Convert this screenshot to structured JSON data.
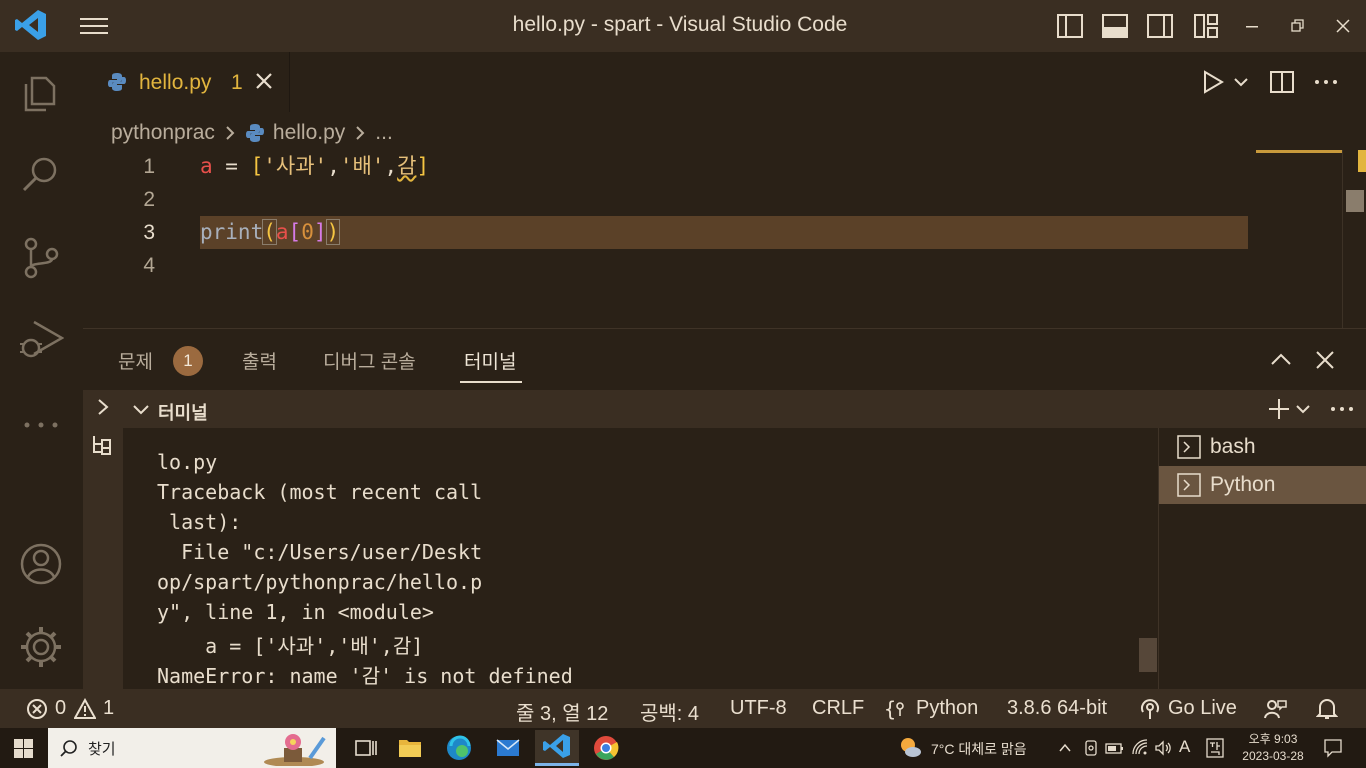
{
  "window": {
    "title": "hello.py - spart - Visual Studio Code"
  },
  "editor": {
    "tab": {
      "label": "hello.py",
      "problem_count": "1"
    },
    "breadcrumb": {
      "folder": "pythonprac",
      "file": "hello.py",
      "more": "..."
    },
    "lines": [
      {
        "number": "1"
      },
      {
        "number": "2"
      },
      {
        "number": "3"
      },
      {
        "number": "4"
      }
    ],
    "code": {
      "line1": {
        "var": "a",
        "eq": " = ",
        "open": "[",
        "s1": "'사과'",
        "c1": ",",
        "s2": "'배'",
        "c2": ",",
        "bad": "감",
        "close": "]"
      },
      "line3": {
        "fn": "print",
        "open": "(",
        "var": "a",
        "open2": "[",
        "num": "0",
        "close2": "]",
        "close": ")"
      }
    }
  },
  "panel": {
    "tabs": [
      {
        "label": "문제"
      },
      {
        "label": "출력"
      },
      {
        "label": "디버그 콘솔"
      },
      {
        "label": "터미널"
      }
    ],
    "problems_badge": "1",
    "terminal_header": "터미널",
    "terminal_lines": [
      "lo.py",
      "Traceback (most recent call",
      " last):",
      "  File \"c:/Users/user/Deskt",
      "op/spart/pythonprac/hello.p",
      "y\", line 1, in <module>",
      "    a = ['사과','배',감]",
      "NameError: name '감' is not defined"
    ],
    "terminals": [
      {
        "label": "bash"
      },
      {
        "label": "Python"
      }
    ]
  },
  "statusbar": {
    "errors": "0",
    "warnings": "1",
    "position": "줄 3, 열 12",
    "spaces": "공백: 4",
    "encoding": "UTF-8",
    "eol": "CRLF",
    "language": "Python",
    "interpreter": "3.8.6 64-bit",
    "golive": "Go Live"
  },
  "taskbar": {
    "search_label": "찾기",
    "weather": "7°C  대체로 맑음",
    "ime": "A",
    "clock_time": "오후 9:03",
    "clock_date": "2023-03-28"
  },
  "colors": {
    "background": "#2a2117",
    "chrome": "#3a2e22",
    "accent_yellow": "#e2b53e",
    "current_line": "#5b4128"
  }
}
